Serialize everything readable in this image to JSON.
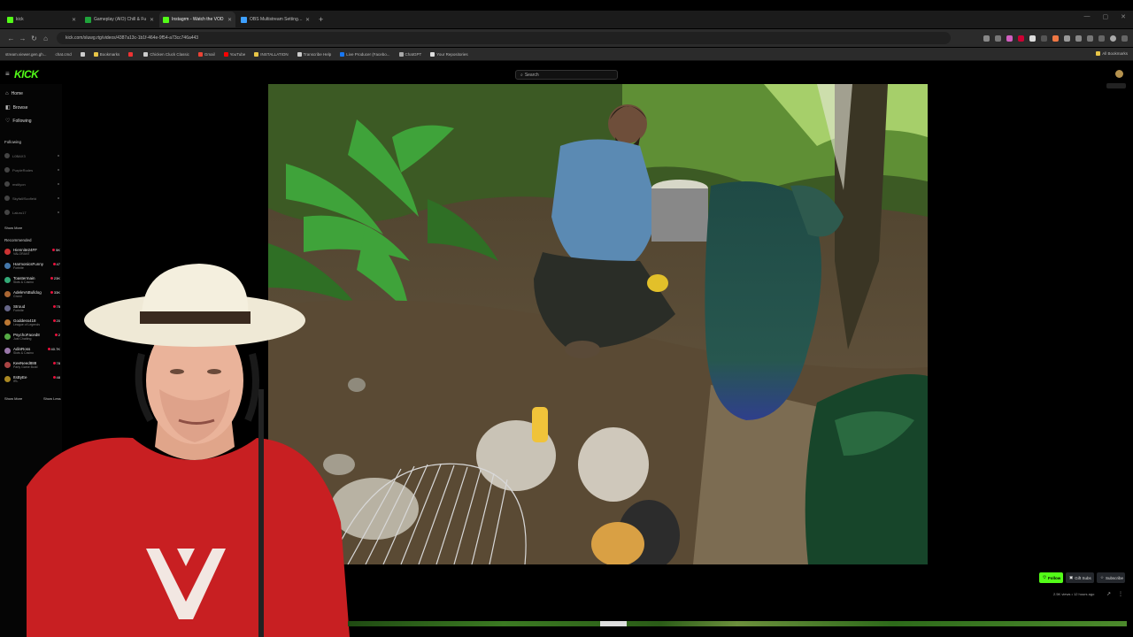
{
  "browser": {
    "tabs": [
      {
        "title": "kick",
        "color": "#53fc18",
        "active": false
      },
      {
        "title": "Gameplay (AIO) Chill & Fu",
        "color": "#1fa33b",
        "active": false
      },
      {
        "title": "Instagrm - Watch the VOD",
        "color": "#53fc18",
        "active": true
      },
      {
        "title": "OBS Multistream Settings / Str",
        "color": "#3ea0ff",
        "active": false
      }
    ],
    "url": "kick.com/sluwg.rtg/videos/4387a13c-1b1f-464e-9f54-a73cc746a443",
    "bookmarks": [
      "stream.viewer.gen.gh...",
      "chat.cmd",
      "Bookmarks",
      "Chicken Cluck Classic",
      "Gmail",
      "YouTube",
      "INSTALLATION",
      "Transcribe Help",
      "Live Producer (Facebo...",
      "ChatGPT",
      "Your Repositories"
    ],
    "all_bookmarks_label": "All Bookmarks"
  },
  "kick": {
    "logo": "KICK",
    "search_placeholder": "Search"
  },
  "sidebar": {
    "nav": [
      {
        "label": "Home",
        "icon": "home-icon"
      },
      {
        "label": "Browse",
        "icon": "browse-icon"
      },
      {
        "label": "Following",
        "icon": "heart-icon"
      }
    ],
    "following_title": "Following",
    "following": [
      "L0BAX3",
      "PurpleRodes",
      "mstilyon",
      "Skyfall/Scofield",
      "Laluru17"
    ],
    "show_more": "Show More",
    "recommended_title": "Recommended",
    "recommended": [
      {
        "name": "Hiennite24FF",
        "category": "VALORANT",
        "viewers": "5K",
        "color": "#c33"
      },
      {
        "name": "HarmonicsFunny",
        "category": "Fortnite",
        "viewers": "47",
        "color": "#47a"
      },
      {
        "name": "Toastermain",
        "category": "Slots & Casino",
        "viewers": "23K",
        "color": "#3a7"
      },
      {
        "name": "AdeleVsBulldog",
        "category": "Grand",
        "viewers": "33K",
        "color": "#a63"
      },
      {
        "name": "Stroud",
        "category": "Fortnite",
        "viewers": "75",
        "color": "#668"
      },
      {
        "name": "Goddess418",
        "category": "League of Legends",
        "viewers": "20",
        "color": "#b73"
      },
      {
        "name": "PsychoFaced8",
        "category": "Just Chatting",
        "viewers": "2",
        "color": "#5a4"
      },
      {
        "name": "AdinRoss",
        "category": "Slots & Casino",
        "viewers": "40.7K",
        "color": "#97a"
      },
      {
        "name": "KeeNeed888",
        "category": "Party Game Build",
        "viewers": "78",
        "color": "#a44"
      },
      {
        "name": "ItsByEe",
        "category": "IRL",
        "viewers": "48",
        "color": "#a82"
      }
    ],
    "show_more_2": "Show More",
    "show_less": "Show Less"
  },
  "stream": {
    "follow_label": "Follow",
    "gift_label": "Gift Subs",
    "subscribe_label": "Subscribe",
    "meta": "2.5K views • 12 hours ago"
  },
  "colors": {
    "accent": "#53fc18"
  }
}
